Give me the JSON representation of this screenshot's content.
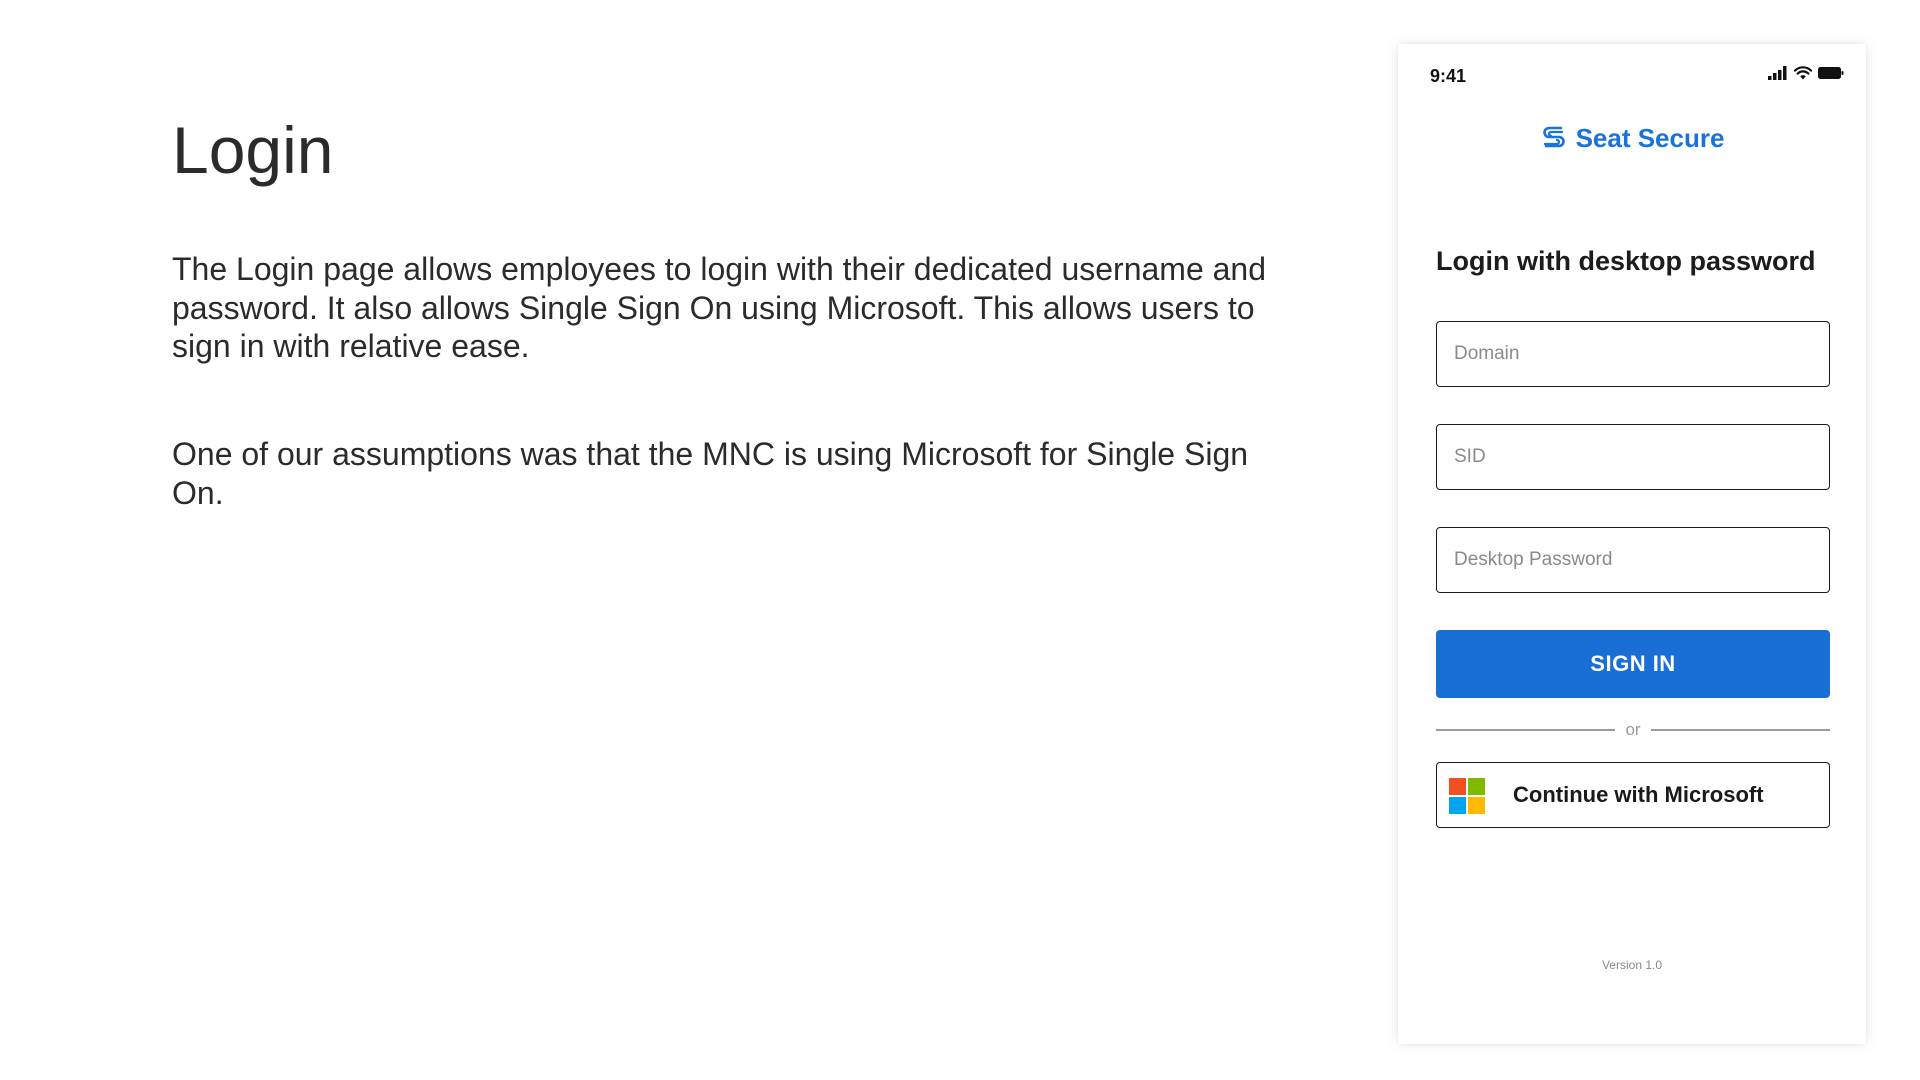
{
  "slide": {
    "title": "Login",
    "paragraphs": [
      "The Login page allows employees to login with their dedicated username and password. It also allows Single Sign On using Microsoft. This allows users to sign in with relative ease.",
      "One of our assumptions was that the MNC is using Microsoft for Single Sign On."
    ]
  },
  "phone": {
    "status_bar": {
      "time": "9:41",
      "icons": [
        "cellular-signal-icon",
        "wifi-icon",
        "battery-icon"
      ]
    },
    "brand": {
      "name": "Seat Secure",
      "icon": "seat-secure-logo-icon",
      "color": "#1a73d9"
    },
    "form": {
      "heading": "Login with desktop password",
      "domain_placeholder": "Domain",
      "sid_placeholder": "SID",
      "password_placeholder": "Desktop Password",
      "signin_label": "SIGN IN",
      "signin_color": "#1a6fd6",
      "divider_text": "or",
      "microsoft_label": "Continue with Microsoft",
      "microsoft_icon": "microsoft-logo-icon"
    },
    "version": "Version 1.0"
  },
  "colors": {
    "ms_red": "#f25022",
    "ms_green": "#7fba00",
    "ms_blue": "#00a4ef",
    "ms_yellow": "#ffb900"
  }
}
